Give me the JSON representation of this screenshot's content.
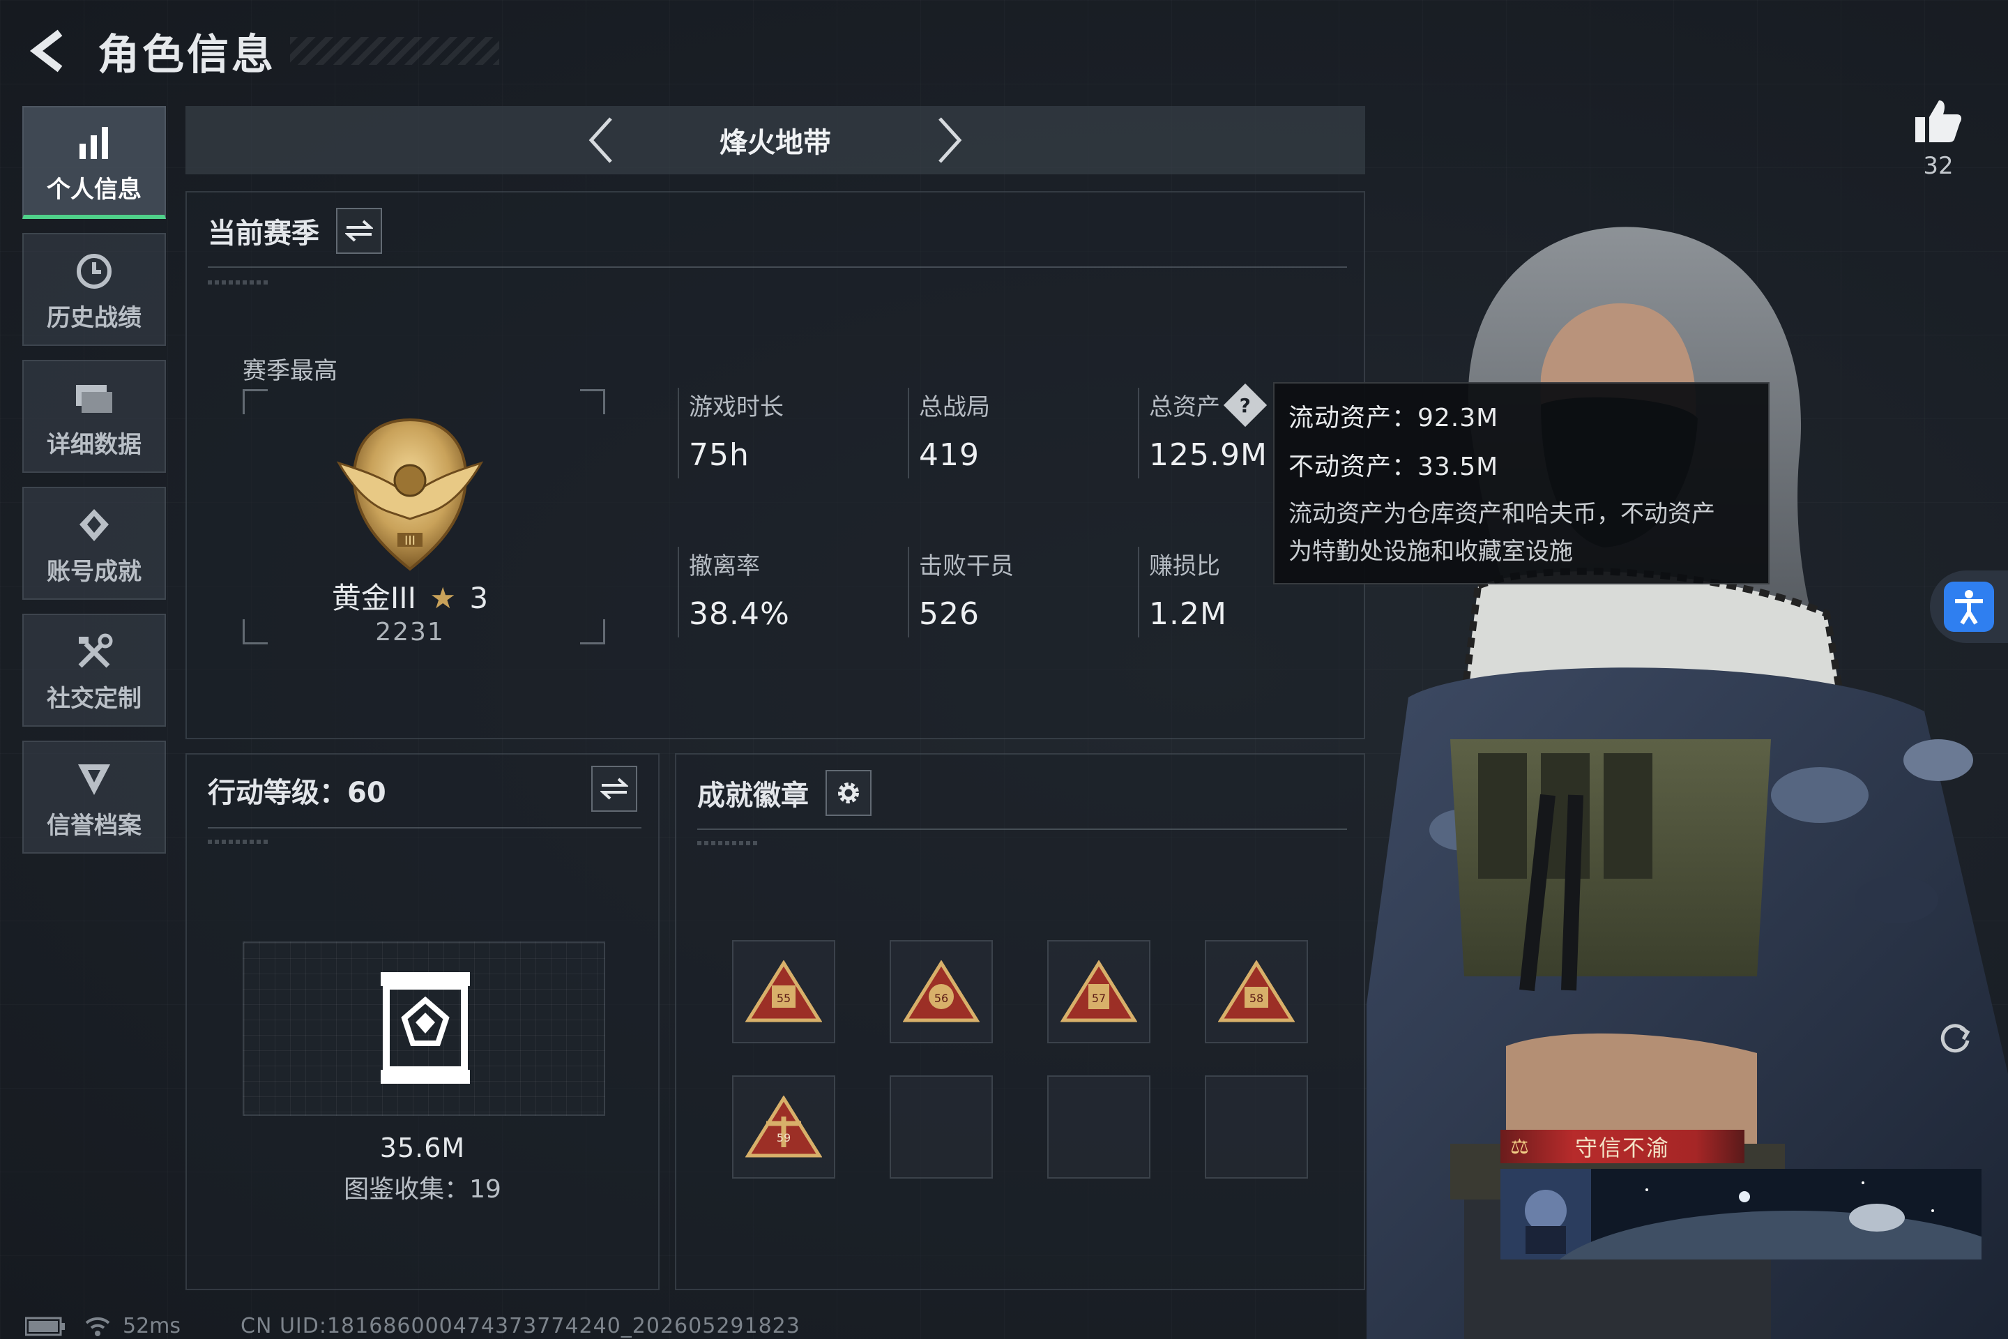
{
  "header": {
    "title": "角色信息"
  },
  "nav": [
    {
      "label": "个人信息",
      "icon": "bar-chart-icon",
      "active": true
    },
    {
      "label": "历史战绩",
      "icon": "history-clock-icon"
    },
    {
      "label": "详细数据",
      "icon": "folder-icon"
    },
    {
      "label": "账号成就",
      "icon": "achievement-icon"
    },
    {
      "label": "社交定制",
      "icon": "tools-icon"
    },
    {
      "label": "信誉档案",
      "icon": "shield-icon"
    }
  ],
  "mode": {
    "title": "烽火地带"
  },
  "season": {
    "title": "当前赛季",
    "best_label": "赛季最高",
    "rank_name": "黄金III",
    "rank_stars": "3",
    "rank_score": "2231",
    "stats": [
      {
        "label": "游戏时长",
        "value": "75h"
      },
      {
        "label": "总战局",
        "value": "419"
      },
      {
        "label": "总资产",
        "value": "125.9M"
      },
      {
        "label": "撤离率",
        "value": "38.4%"
      },
      {
        "label": "击败干员",
        "value": "526"
      },
      {
        "label": "赚损比",
        "value": "1.2M"
      }
    ]
  },
  "tooltip": {
    "liquid": "流动资产：92.3M",
    "fixed": "不动资产：33.5M",
    "desc_line1": "流动资产为仓库资产和哈夫币，不动资产",
    "desc_line2": "为特勤处设施和收藏室设施"
  },
  "level": {
    "title": "行动等级：60",
    "value": "35.6M",
    "collect": "图鉴收集：19"
  },
  "badges": {
    "title": "成就徽章",
    "items": [
      "55",
      "56",
      "57",
      "58",
      "59"
    ]
  },
  "likes": {
    "count": "32"
  },
  "player_title": "守信不渝",
  "footer": {
    "ping": "52ms",
    "uid": "CN UID:18168600047437377424​0_202605291823"
  },
  "colors": {
    "accent_green": "#4fd18a",
    "rank_gold": "#c9a25a",
    "title_red": "#b72b2b"
  }
}
